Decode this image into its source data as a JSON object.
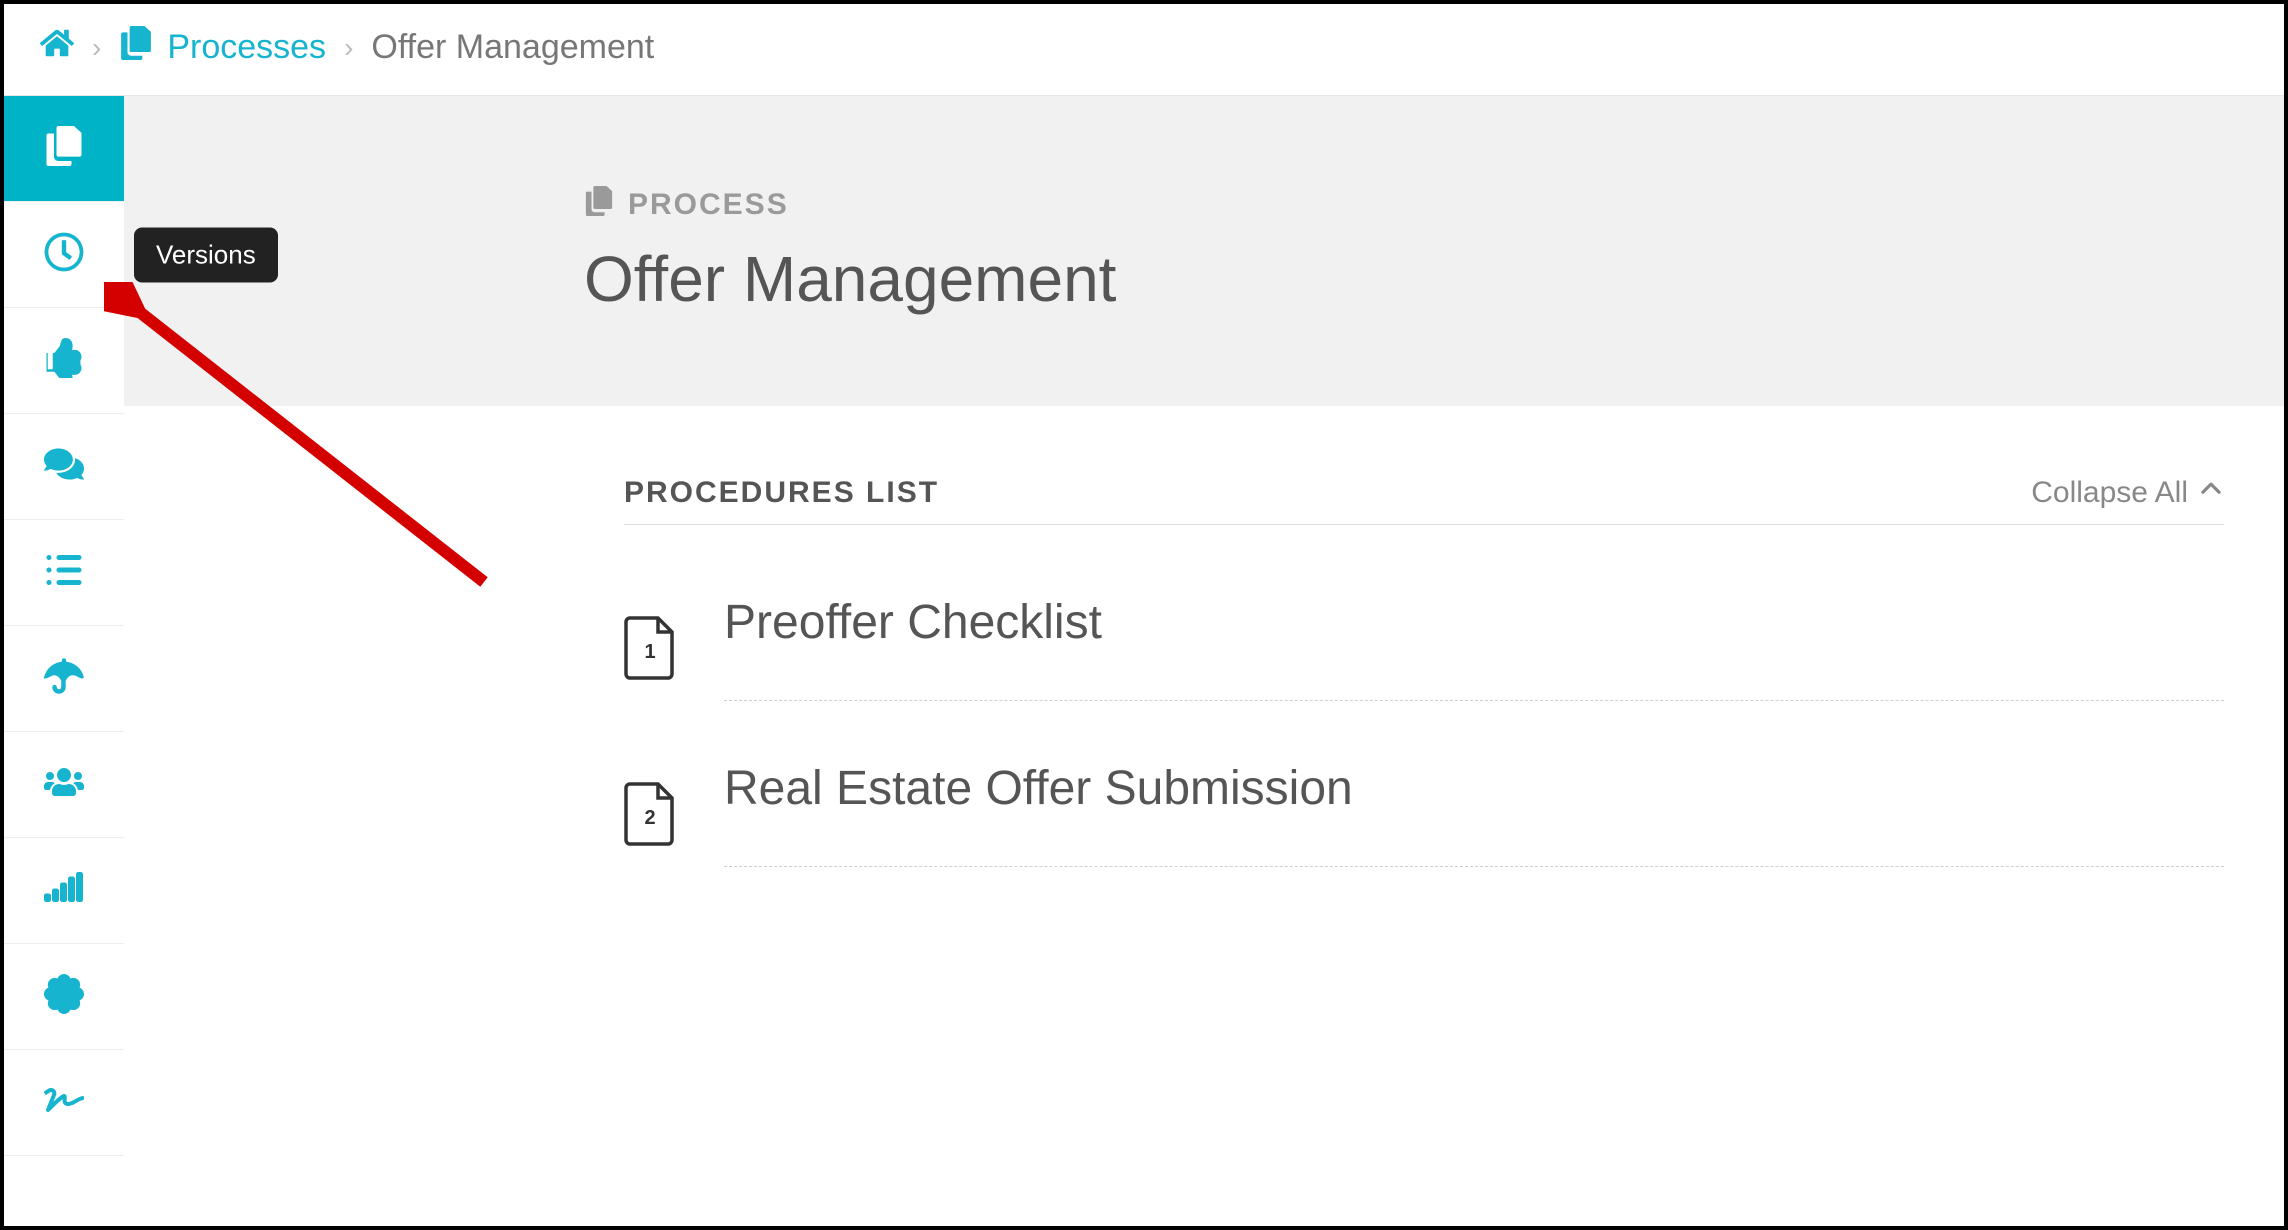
{
  "breadcrumb": {
    "processes_label": "Processes",
    "current": "Offer Management"
  },
  "sidebar": {
    "items": [
      {
        "name": "copy-icon"
      },
      {
        "name": "clock-icon",
        "tooltip": "Versions"
      },
      {
        "name": "thumbs-up-icon"
      },
      {
        "name": "chat-icon"
      },
      {
        "name": "list-icon"
      },
      {
        "name": "umbrella-icon"
      },
      {
        "name": "users-icon"
      },
      {
        "name": "signal-icon"
      },
      {
        "name": "badge-icon"
      },
      {
        "name": "signature-icon"
      }
    ]
  },
  "header": {
    "eyebrow": "PROCESS",
    "title": "Offer Management"
  },
  "procedures": {
    "list_label": "PROCEDURES LIST",
    "collapse_label": "Collapse All",
    "items": [
      {
        "index": "1",
        "label": "Preoffer Checklist"
      },
      {
        "index": "2",
        "label": "Real Estate Offer Submission"
      }
    ]
  },
  "colors": {
    "accent": "#16b4cf"
  }
}
